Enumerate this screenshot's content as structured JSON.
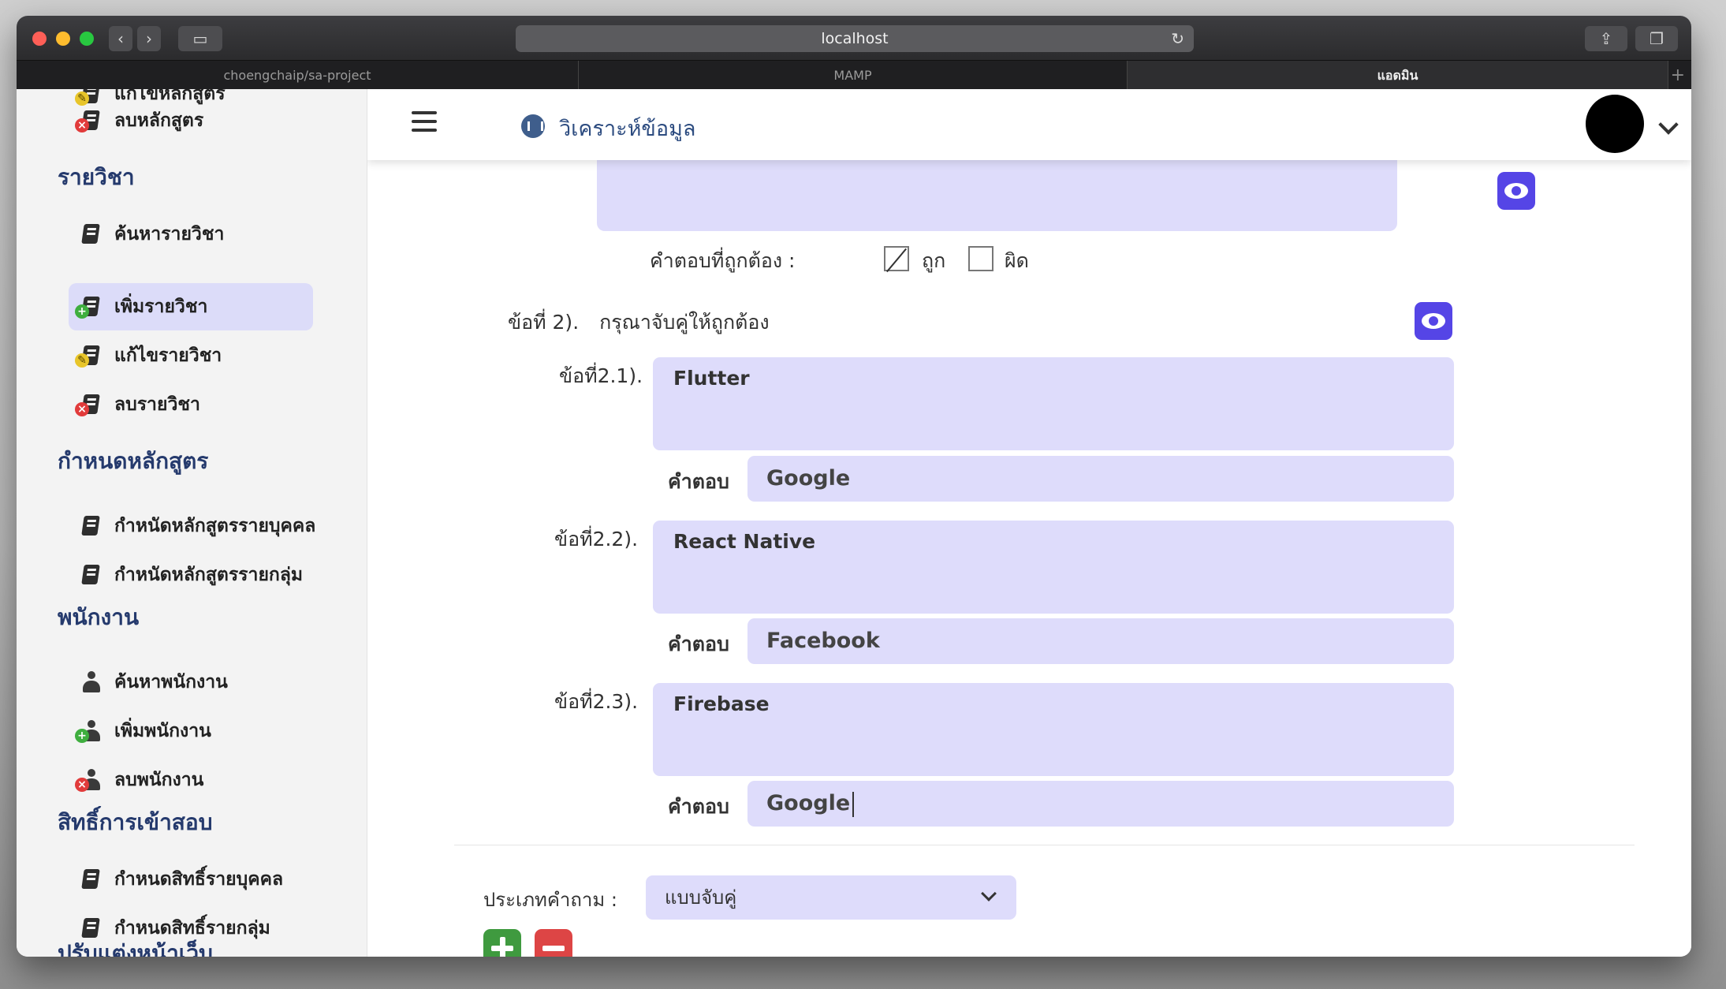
{
  "browser": {
    "url": "localhost",
    "tabs": [
      "choengchaip/sa-project",
      "MAMP",
      "แอดมิน"
    ]
  },
  "sidebar": {
    "top_cut_item": "แก้ไขหลักสูตร",
    "delete_course": "ลบหลักสูตร",
    "subjects_heading": "รายวิชา",
    "subjects": [
      "ค้นหารายวิชา",
      "เพิ่มรายวิชา",
      "แก้ไขรายวิชา",
      "ลบรายวิชา"
    ],
    "curriculum_heading": "กำหนดหลักสูตร",
    "curriculum": [
      "กำหนัดหลักสูตรรายบุคคล",
      "กำหนัดหลักสูตรรายกลุ่ม"
    ],
    "employees_heading": "พนักงาน",
    "employees": [
      "ค้นหาพนักงาน",
      "เพิ่มพนักงาน",
      "ลบพนักงาน"
    ],
    "permissions_heading": "สิทธิ์การเข้าสอบ",
    "permissions": [
      "กำหนดสิทธิ์รายบุคคล",
      "กำหนดสิทธิ์รายกลุ่ม"
    ],
    "bottom_cut_heading": "ปรับแต่งหน้าเว็บ"
  },
  "header": {
    "title": "วิเคราะห์ข้อมูล"
  },
  "form": {
    "correct_answer_label": "คำตอบที่ถูกต้อง :",
    "true_label": "ถูก",
    "false_label": "ผิด",
    "question_label": "ข้อที่ 2).",
    "question_text": "กรุณาจับคู่ให้ถูกต้อง",
    "answer_label": "คำตอบ",
    "sub_questions": [
      {
        "label": "ข้อที่2.1).",
        "text": "Flutter",
        "answer": "Google"
      },
      {
        "label": "ข้อที่2.2).",
        "text": "React Native",
        "answer": "Facebook"
      },
      {
        "label": "ข้อที่2.3).",
        "text": "Firebase",
        "answer": "Google"
      }
    ],
    "question_type_label": "ประเภทคำถาม :",
    "question_type_value": "แบบจับคู่"
  },
  "colors": {
    "accent": "#5545e6",
    "field_bg": "#dedcfb",
    "heading": "#253a6d",
    "add_green": "#3f9a3f",
    "remove_red": "#dd4545"
  },
  "icons": [
    "menu-icon",
    "analytics-icon",
    "eye-icon",
    "book-icon",
    "person-icon",
    "plus-icon",
    "minus-icon",
    "chevron-down-icon"
  ]
}
